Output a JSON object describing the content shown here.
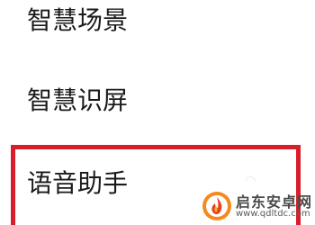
{
  "settings": {
    "items": [
      {
        "label": "智慧场景"
      },
      {
        "label": "智慧识屏"
      },
      {
        "label": "语音助手"
      }
    ]
  },
  "highlight": {
    "color": "#d81e2a",
    "target": "语音助手"
  },
  "watermark": {
    "name": "启东安卓网",
    "url": "www.qdltdc.com",
    "icon": "flame-logo-icon"
  }
}
